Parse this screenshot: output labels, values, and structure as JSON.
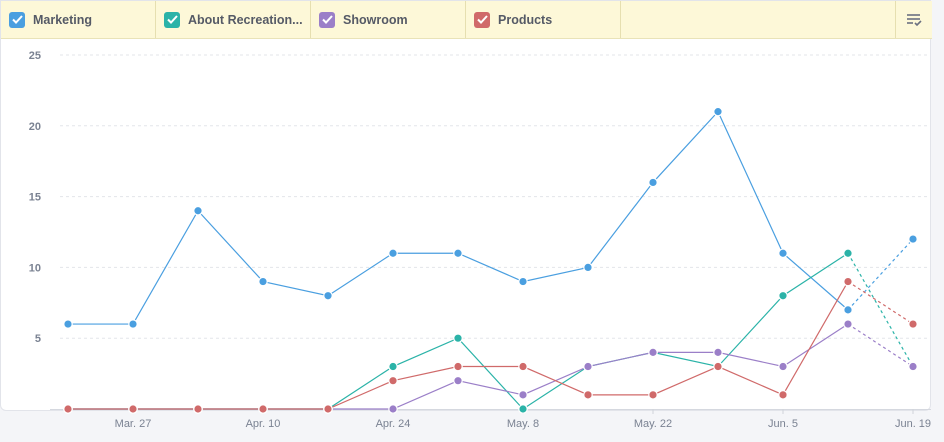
{
  "legend": {
    "items": [
      {
        "label": "Marketing",
        "color": "#4a9fe0"
      },
      {
        "label": "About Recreation...",
        "color": "#2bb3a8"
      },
      {
        "label": "Showroom",
        "color": "#9b7fc8"
      },
      {
        "label": "Products",
        "color": "#d06a6a"
      }
    ],
    "menu_icon": "list-check-icon"
  },
  "chart_data": {
    "type": "line",
    "x": [
      "Mar. 20",
      "Mar. 27",
      "Apr. 3",
      "Apr. 10",
      "Apr. 17",
      "Apr. 24",
      "May. 1",
      "May. 8",
      "May. 15",
      "May. 22",
      "May. 29",
      "Jun. 5",
      "Jun. 12",
      "Jun. 19"
    ],
    "x_tick_labels": [
      "Mar. 27",
      "Apr. 10",
      "Apr. 24",
      "May. 8",
      "May. 22",
      "Jun. 5",
      "Jun. 19"
    ],
    "ylim": [
      0,
      25
    ],
    "y_ticks": [
      5,
      10,
      15,
      20,
      25
    ],
    "grid": "horizontal dashed",
    "last_segment_dashed": true,
    "series": [
      {
        "name": "Marketing",
        "color": "#4a9fe0",
        "values": [
          6,
          6,
          14,
          9,
          8,
          11,
          11,
          9,
          10,
          16,
          21,
          11,
          7,
          12
        ]
      },
      {
        "name": "About Recreation...",
        "color": "#2bb3a8",
        "values": [
          0,
          0,
          0,
          0,
          0,
          3,
          5,
          0,
          3,
          4,
          3,
          8,
          11,
          3
        ]
      },
      {
        "name": "Showroom",
        "color": "#9b7fc8",
        "values": [
          0,
          0,
          0,
          0,
          0,
          0,
          2,
          1,
          3,
          4,
          4,
          3,
          6,
          3
        ]
      },
      {
        "name": "Products",
        "color": "#d06a6a",
        "values": [
          0,
          0,
          0,
          0,
          0,
          2,
          3,
          3,
          1,
          1,
          3,
          1,
          9,
          6
        ]
      }
    ]
  }
}
